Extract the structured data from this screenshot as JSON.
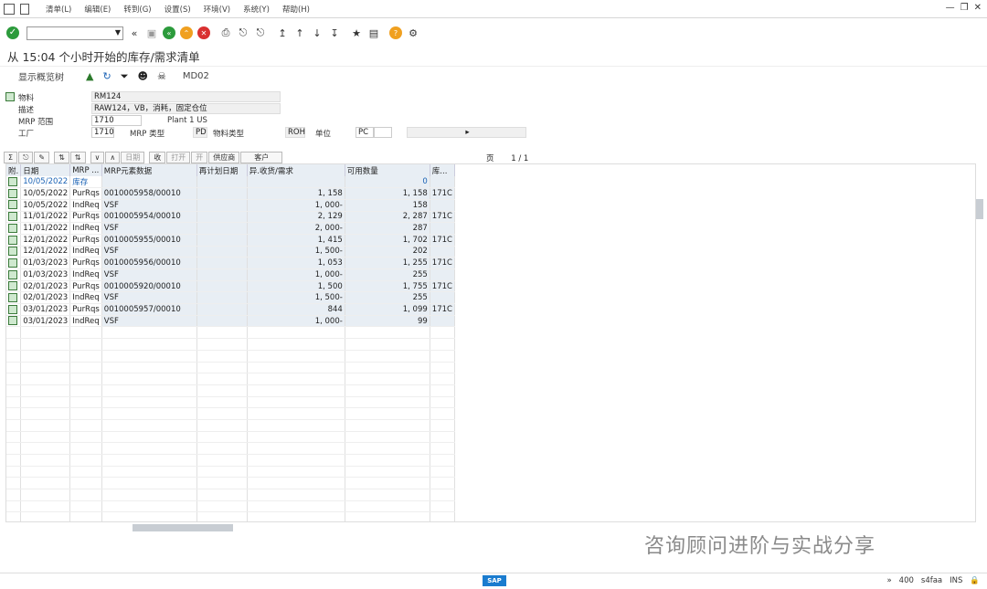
{
  "menubar": {
    "items": [
      "清单(L)",
      "编辑(E)",
      "转到(G)",
      "设置(S)",
      "环境(V)",
      "系统(Y)",
      "帮助(H)"
    ]
  },
  "toolbar": {
    "ok_icon": "check-icon"
  },
  "title": "从 15:04 个小时开始的库存/需求清单",
  "apptb": {
    "display_tree": "显示概览树",
    "tcode": "MD02"
  },
  "header": {
    "material_label": "物料",
    "material_value": "RM124",
    "desc_label": "描述",
    "desc_value": "RAW124，VB，消耗，固定仓位",
    "mrp_area_label": "MRP 范围",
    "mrp_area_value": "1710",
    "mrp_area_text": "Plant 1 US",
    "plant_label": "工厂",
    "plant_value": "1710",
    "mrp_type_label": "MRP 类型",
    "mrp_type_value": "PD",
    "mat_type_label": "物料类型",
    "mat_type_value": "ROH",
    "unit_label": "单位",
    "unit_value": "PC"
  },
  "gridtb": {
    "date_btn": "日期",
    "receipt_btn": "收",
    "open_btn": "打开",
    "open2_btn": "开",
    "vendor_btn": "供应商",
    "customer_btn": "客户",
    "page_label": "页",
    "page_value": "1 / 1"
  },
  "columns": [
    "附.",
    "日期",
    "MRP ...",
    "MRP元素数据",
    "再计划日期",
    "异.收货/需求",
    "可用数量",
    "库..."
  ],
  "rows": [
    {
      "date": "10/05/2022",
      "mrp": "库存",
      "data": "",
      "qty": "",
      "avail": "0",
      "stor": "",
      "highlight": true
    },
    {
      "date": "10/05/2022",
      "mrp": "PurRqs",
      "data": "0010005958/00010",
      "qty": "1, 158",
      "avail": "1, 158",
      "stor": "171C"
    },
    {
      "date": "10/05/2022",
      "mrp": "IndReq",
      "data": "VSF",
      "qty": "1, 000-",
      "avail": "158",
      "stor": ""
    },
    {
      "date": "11/01/2022",
      "mrp": "PurRqs",
      "data": "0010005954/00010",
      "qty": "2, 129",
      "avail": "2, 287",
      "stor": "171C"
    },
    {
      "date": "11/01/2022",
      "mrp": "IndReq",
      "data": "VSF",
      "qty": "2, 000-",
      "avail": "287",
      "stor": ""
    },
    {
      "date": "12/01/2022",
      "mrp": "PurRqs",
      "data": "0010005955/00010",
      "qty": "1, 415",
      "avail": "1, 702",
      "stor": "171C"
    },
    {
      "date": "12/01/2022",
      "mrp": "IndReq",
      "data": "VSF",
      "qty": "1, 500-",
      "avail": "202",
      "stor": ""
    },
    {
      "date": "01/03/2023",
      "mrp": "PurRqs",
      "data": "0010005956/00010",
      "qty": "1, 053",
      "avail": "1, 255",
      "stor": "171C"
    },
    {
      "date": "01/03/2023",
      "mrp": "IndReq",
      "data": "VSF",
      "qty": "1, 000-",
      "avail": "255",
      "stor": ""
    },
    {
      "date": "02/01/2023",
      "mrp": "PurRqs",
      "data": "0010005920/00010",
      "qty": "1, 500",
      "avail": "1, 755",
      "stor": "171C"
    },
    {
      "date": "02/01/2023",
      "mrp": "IndReq",
      "data": "VSF",
      "qty": "1, 500-",
      "avail": "255",
      "stor": ""
    },
    {
      "date": "03/01/2023",
      "mrp": "PurRqs",
      "data": "0010005957/00010",
      "qty": "844",
      "avail": "1, 099",
      "stor": "171C"
    },
    {
      "date": "03/01/2023",
      "mrp": "IndReq",
      "data": "VSF",
      "qty": "1, 000-",
      "avail": "99",
      "stor": ""
    }
  ],
  "watermark": "咨询顾问进阶与实战分享",
  "status": {
    "sap": "SAP",
    "zoom": "400",
    "system": "s4faa",
    "mode": "INS"
  }
}
